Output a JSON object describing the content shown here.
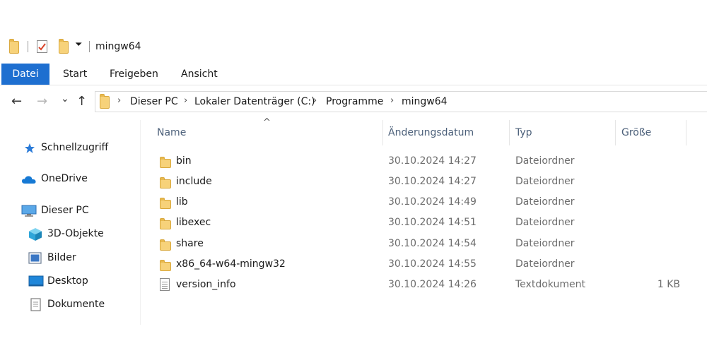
{
  "window": {
    "title": "mingw64"
  },
  "quick_access": {
    "dropdown_glyph": "⏷"
  },
  "ribbon": {
    "tabs": [
      {
        "label": "Datei",
        "active": true
      },
      {
        "label": "Start"
      },
      {
        "label": "Freigeben"
      },
      {
        "label": "Ansicht"
      }
    ]
  },
  "nav": {
    "back": "←",
    "forward": "→",
    "recent": "⌄",
    "up": "↑"
  },
  "address": {
    "separator": "›",
    "crumbs": [
      "Dieser PC",
      "Lokaler Datenträger (C:)",
      "Programme",
      "mingw64"
    ]
  },
  "sidebar": {
    "items": [
      {
        "label": "Schnellzugriff",
        "icon": "star-icon"
      },
      {
        "label": "OneDrive",
        "icon": "cloud-icon"
      },
      {
        "label": "Dieser PC",
        "icon": "computer-icon"
      },
      {
        "label": "3D-Objekte",
        "icon": "cube-icon"
      },
      {
        "label": "Bilder",
        "icon": "pictures-icon"
      },
      {
        "label": "Desktop",
        "icon": "desktop-icon"
      },
      {
        "label": "Dokumente",
        "icon": "documents-icon"
      }
    ]
  },
  "columns": {
    "sort_glyph": "^",
    "name": "Name",
    "date": "Änderungsdatum",
    "type": "Typ",
    "size": "Größe"
  },
  "files": [
    {
      "name": "bin",
      "date": "30.10.2024 14:27",
      "type": "Dateiordner",
      "size": "",
      "icon": "folder-icon"
    },
    {
      "name": "include",
      "date": "30.10.2024 14:27",
      "type": "Dateiordner",
      "size": "",
      "icon": "folder-icon"
    },
    {
      "name": "lib",
      "date": "30.10.2024 14:49",
      "type": "Dateiordner",
      "size": "",
      "icon": "folder-icon"
    },
    {
      "name": "libexec",
      "date": "30.10.2024 14:51",
      "type": "Dateiordner",
      "size": "",
      "icon": "folder-icon"
    },
    {
      "name": "share",
      "date": "30.10.2024 14:54",
      "type": "Dateiordner",
      "size": "",
      "icon": "folder-icon"
    },
    {
      "name": "x86_64-w64-mingw32",
      "date": "30.10.2024 14:55",
      "type": "Dateiordner",
      "size": "",
      "icon": "folder-icon"
    },
    {
      "name": "version_info",
      "date": "30.10.2024 14:26",
      "type": "Textdokument",
      "size": "1 KB",
      "icon": "text-file-icon"
    }
  ],
  "colors": {
    "accent": "#1e6fd0",
    "folder": "#f7d27a",
    "header_text": "#4c607a"
  }
}
